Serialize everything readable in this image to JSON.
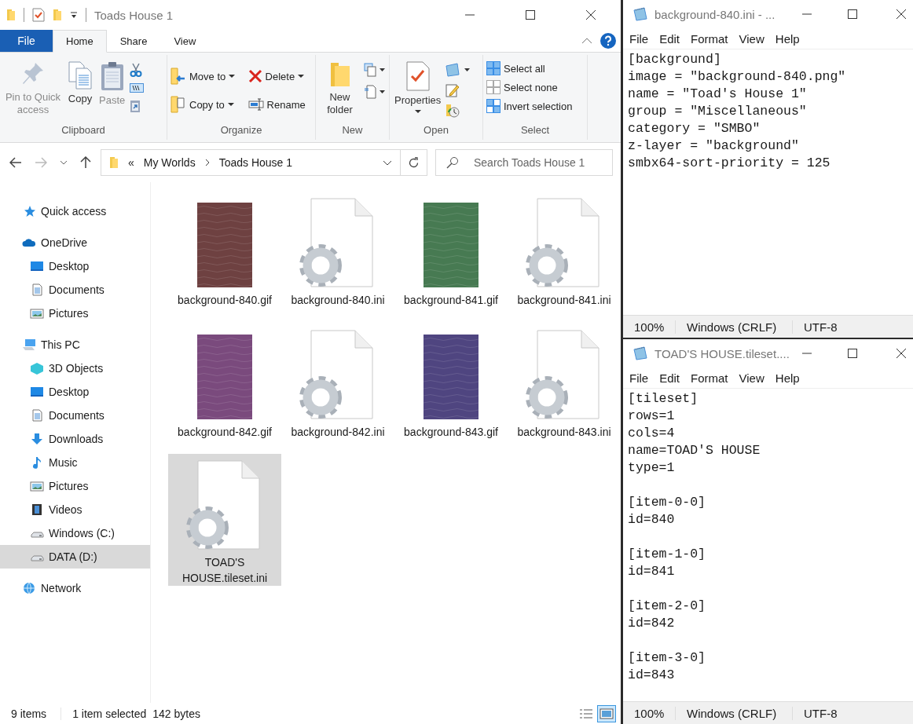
{
  "explorer": {
    "title": "Toads House 1",
    "tabs": [
      {
        "label": "File",
        "kind": "menu",
        "selected": false
      },
      {
        "label": "Home",
        "kind": "tab",
        "selected": true
      },
      {
        "label": "Share",
        "kind": "tab",
        "selected": false
      },
      {
        "label": "View",
        "kind": "tab",
        "selected": false
      }
    ],
    "ribbon": {
      "groups": [
        {
          "label": "Clipboard",
          "buttons": [
            {
              "label": "Pin to Quick access",
              "disabled": true,
              "dropdown": false
            },
            {
              "label": "Copy",
              "disabled": false,
              "dropdown": false
            },
            {
              "label": "Paste",
              "disabled": true,
              "dropdown": false
            }
          ]
        },
        {
          "label": "Organize",
          "buttons": [
            {
              "label": "Move to",
              "disabled": false,
              "dropdown": true
            },
            {
              "label": "Copy to",
              "disabled": false,
              "dropdown": true
            },
            {
              "label": "Delete",
              "disabled": false,
              "dropdown": true
            },
            {
              "label": "Rename",
              "disabled": false,
              "dropdown": false
            }
          ]
        },
        {
          "label": "New",
          "buttons": [
            {
              "label": "New folder",
              "disabled": false,
              "dropdown": false
            }
          ]
        },
        {
          "label": "Open",
          "buttons": [
            {
              "label": "Properties",
              "disabled": false,
              "dropdown": true
            }
          ]
        },
        {
          "label": "Select",
          "buttons": [
            {
              "label": "Select all",
              "disabled": false,
              "dropdown": false
            },
            {
              "label": "Select none",
              "disabled": false,
              "dropdown": false
            },
            {
              "label": "Invert selection",
              "disabled": false,
              "dropdown": false
            }
          ]
        }
      ]
    },
    "address": {
      "overflow": "«",
      "crumbs": [
        "My Worlds",
        "Toads House 1"
      ]
    },
    "search": {
      "placeholder": "Search Toads House 1"
    },
    "nav": [
      {
        "label": "Quick access",
        "selected": false
      },
      {
        "label": "OneDrive",
        "selected": false,
        "children": [
          {
            "label": "Desktop",
            "selected": false
          },
          {
            "label": "Documents",
            "selected": false
          },
          {
            "label": "Pictures",
            "selected": false
          }
        ]
      },
      {
        "label": "This PC",
        "selected": false,
        "children": [
          {
            "label": "3D Objects",
            "selected": false
          },
          {
            "label": "Desktop",
            "selected": false
          },
          {
            "label": "Documents",
            "selected": false
          },
          {
            "label": "Downloads",
            "selected": false
          },
          {
            "label": "Music",
            "selected": false
          },
          {
            "label": "Pictures",
            "selected": false
          },
          {
            "label": "Videos",
            "selected": false
          },
          {
            "label": "Windows (C:)",
            "selected": false
          },
          {
            "label": "DATA (D:)",
            "selected": true
          }
        ]
      },
      {
        "label": "Network",
        "selected": false
      }
    ],
    "files": [
      {
        "name": "background-840.gif",
        "kind": "image",
        "color": "#6e4141",
        "selected": false
      },
      {
        "name": "background-840.ini",
        "kind": "config",
        "selected": false
      },
      {
        "name": "background-841.gif",
        "kind": "image",
        "color": "#477a52",
        "selected": false
      },
      {
        "name": "background-841.ini",
        "kind": "config",
        "selected": false
      },
      {
        "name": "background-842.gif",
        "kind": "image",
        "color": "#7a4a7d",
        "selected": false
      },
      {
        "name": "background-842.ini",
        "kind": "config",
        "selected": false
      },
      {
        "name": "background-843.gif",
        "kind": "image",
        "color": "#4f4580",
        "selected": false
      },
      {
        "name": "background-843.ini",
        "kind": "config",
        "selected": false
      },
      {
        "name": "TOAD'S HOUSE.tileset.ini",
        "kind": "config",
        "selected": true
      }
    ],
    "status_bar": [
      "9 items",
      "1 item selected",
      "142 bytes"
    ],
    "view_modes": [
      {
        "selected": false
      },
      {
        "selected": true
      }
    ]
  },
  "notepads": [
    {
      "title": "background-840.ini - ...",
      "menu": [
        "File",
        "Edit",
        "Format",
        "View",
        "Help"
      ],
      "sections": [
        [
          "[background]",
          "image = \"background-840.png\"",
          "name = \"Toad's House 1\"",
          "group = \"Miscellaneous\"",
          "category = \"SMBO\"",
          "z-layer = \"background\"",
          "smbx64-sort-priority = 125"
        ]
      ],
      "status": [
        "100%",
        "Windows (CRLF)",
        "UTF-8"
      ]
    },
    {
      "title": "TOAD'S HOUSE.tileset....",
      "menu": [
        "File",
        "Edit",
        "Format",
        "View",
        "Help"
      ],
      "sections": [
        [
          "[tileset]",
          "rows=1",
          "cols=4",
          "name=TOAD'S HOUSE",
          "type=1"
        ],
        [
          "[item-0-0]",
          "id=840"
        ],
        [
          "[item-1-0]",
          "id=841"
        ],
        [
          "[item-2-0]",
          "id=842"
        ],
        [
          "[item-3-0]",
          "id=843"
        ]
      ],
      "status": [
        "100%",
        "Windows (CRLF)",
        "UTF-8"
      ]
    }
  ]
}
